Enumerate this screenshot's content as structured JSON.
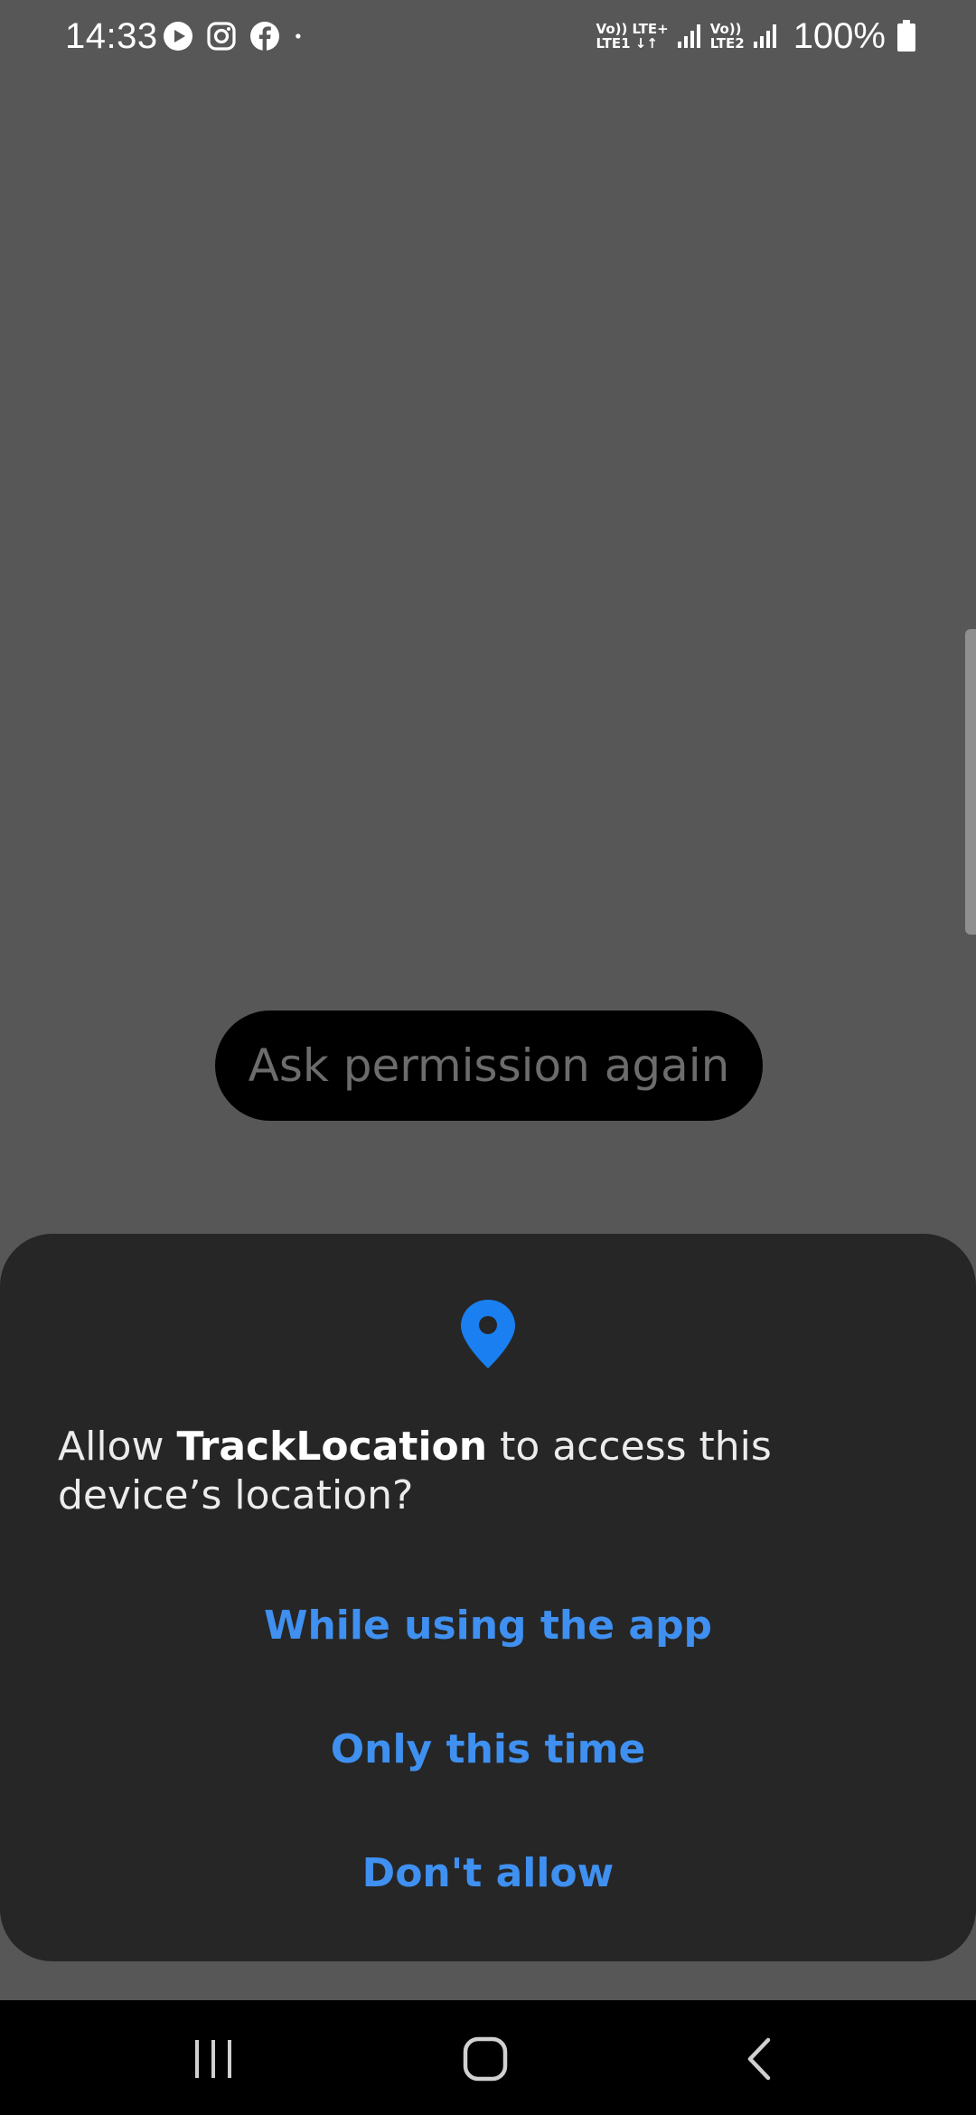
{
  "status_bar": {
    "time": "14:33",
    "notification_icons": [
      "youtube-icon",
      "instagram-icon",
      "facebook-icon",
      "more-dot-icon"
    ],
    "sim1": {
      "top": "Vo)) LTE+",
      "bottom": "LTE1 ↓↑"
    },
    "sim2": {
      "top": "Vo))",
      "bottom": "LTE2"
    },
    "battery_level": "100%"
  },
  "main": {
    "ask_button_label": "Ask permission again"
  },
  "dialog": {
    "icon": "location-pin-icon",
    "text_prefix": "Allow ",
    "app_name": "TrackLocation",
    "text_suffix": " to access this device’s location?",
    "options": {
      "while_using": "While using the app",
      "only_this_time": "Only this time",
      "dont_allow": "Don't allow"
    }
  },
  "nav_bar": {
    "icons": [
      "recents-icon",
      "home-icon",
      "back-icon"
    ]
  },
  "colors": {
    "background": "#575757",
    "sheet": "#262626",
    "accent": "#3f90f0",
    "pin": "#1a7ff0"
  }
}
